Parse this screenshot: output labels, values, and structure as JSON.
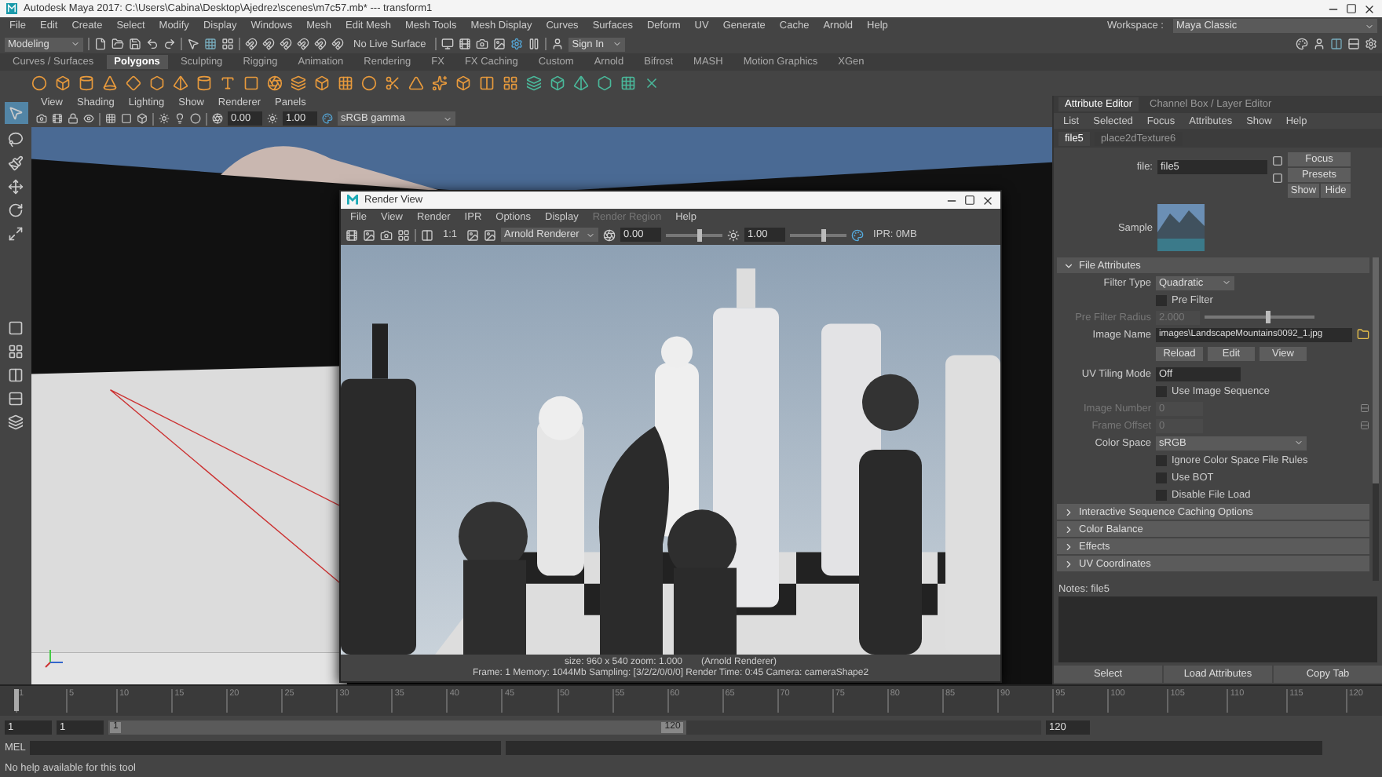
{
  "window": {
    "title": "Autodesk Maya 2017: C:\\Users\\Cabina\\Desktop\\Ajedrez\\scenes\\m7c57.mb*  ---  transform1"
  },
  "main_menu": [
    "File",
    "Edit",
    "Create",
    "Select",
    "Modify",
    "Display",
    "Windows",
    "Mesh",
    "Edit Mesh",
    "Mesh Tools",
    "Mesh Display",
    "Curves",
    "Surfaces",
    "Deform",
    "UV",
    "Generate",
    "Cache",
    "Arnold",
    "Help"
  ],
  "workspace": {
    "label": "Workspace :",
    "value": "Maya Classic"
  },
  "status_line": {
    "mode": "Modeling",
    "live_surface": "No Live Surface",
    "sign_in": "Sign In"
  },
  "shelf_tabs": [
    {
      "label": "Curves / Surfaces",
      "selected": false
    },
    {
      "label": "Polygons",
      "selected": true
    },
    {
      "label": "Sculpting",
      "selected": false
    },
    {
      "label": "Rigging",
      "selected": false
    },
    {
      "label": "Animation",
      "selected": false
    },
    {
      "label": "Rendering",
      "selected": false
    },
    {
      "label": "FX",
      "selected": false
    },
    {
      "label": "FX Caching",
      "selected": false
    },
    {
      "label": "Custom",
      "selected": false
    },
    {
      "label": "Arnold",
      "selected": false
    },
    {
      "label": "Bifrost",
      "selected": false
    },
    {
      "label": "MASH",
      "selected": false
    },
    {
      "label": "Motion Graphics",
      "selected": false
    },
    {
      "label": "XGen",
      "selected": false
    }
  ],
  "viewport": {
    "menu": [
      "View",
      "Shading",
      "Lighting",
      "Show",
      "Renderer",
      "Panels"
    ],
    "exposure": "0.00",
    "gamma": "1.00",
    "color_space": "sRGB gamma"
  },
  "render_view": {
    "title": "Render View",
    "menu": [
      {
        "label": "File",
        "disabled": false
      },
      {
        "label": "View",
        "disabled": false
      },
      {
        "label": "Render",
        "disabled": false
      },
      {
        "label": "IPR",
        "disabled": false
      },
      {
        "label": "Options",
        "disabled": false
      },
      {
        "label": "Display",
        "disabled": false
      },
      {
        "label": "Render Region",
        "disabled": true
      },
      {
        "label": "Help",
        "disabled": false
      }
    ],
    "ratio": "1:1",
    "renderer": "Arnold Renderer",
    "exposure": "0.00",
    "gamma": "1.00",
    "ipr": "IPR: 0MB",
    "size_line": "size: 960 x 540 zoom: 1.000",
    "renderer_note": "(Arnold Renderer)",
    "status": "Frame: 1   Memory: 1044Mb   Sampling: [3/2/2/0/0/0]   Render Time: 0:45   Camera: cameraShape2"
  },
  "attribute_editor": {
    "tabs": [
      {
        "label": "Attribute Editor",
        "selected": true
      },
      {
        "label": "Channel Box / Layer Editor",
        "selected": false
      }
    ],
    "menu": [
      "List",
      "Selected",
      "Focus",
      "Attributes",
      "Show",
      "Help"
    ],
    "node_tabs": [
      {
        "label": "file5",
        "selected": true
      },
      {
        "label": "place2dTexture6",
        "selected": false
      }
    ],
    "node_label": "file:",
    "node_name": "file5",
    "focus": "Focus",
    "presets": "Presets",
    "show": "Show",
    "hide": "Hide",
    "sample_label": "Sample",
    "sections": [
      {
        "label": "File Attributes",
        "expanded": true,
        "rows": [
          {
            "kind": "dropdown",
            "label": "Filter Type",
            "value": "Quadratic",
            "disabled": false
          },
          {
            "kind": "checkbox",
            "label": "Pre Filter",
            "checked": false,
            "disabled": false
          },
          {
            "kind": "slider",
            "label": "Pre Filter Radius",
            "value": "2.000",
            "level": 0.55,
            "disabled": true
          },
          {
            "kind": "path",
            "label": "Image Name",
            "value": "images\\LandscapeMountains0092_1.jpg",
            "disabled": false
          },
          {
            "kind": "buttons",
            "buttons": [
              "Reload",
              "Edit",
              "View"
            ]
          },
          {
            "kind": "field",
            "label": "UV Tiling Mode",
            "value": "Off",
            "disabled": false
          },
          {
            "kind": "checkbox",
            "label": "Use Image Sequence",
            "checked": false,
            "disabled": false
          },
          {
            "kind": "spinner",
            "label": "Image Number",
            "value": "0",
            "disabled": true
          },
          {
            "kind": "spinner",
            "label": "Frame Offset",
            "value": "0",
            "disabled": true
          },
          {
            "kind": "wide_dropdown",
            "label": "Color Space",
            "value": "sRGB",
            "disabled": false
          },
          {
            "kind": "checkbox",
            "label": "Ignore Color Space File Rules",
            "checked": false,
            "disabled": false
          },
          {
            "kind": "checkbox",
            "label": "Use BOT",
            "checked": false,
            "disabled": false
          },
          {
            "kind": "checkbox",
            "label": "Disable File Load",
            "checked": false,
            "disabled": false
          }
        ]
      },
      {
        "label": "Interactive Sequence Caching Options",
        "expanded": false
      },
      {
        "label": "Color Balance",
        "expanded": false
      },
      {
        "label": "Effects",
        "expanded": false
      },
      {
        "label": "UV Coordinates",
        "expanded": false
      }
    ],
    "notes_label": "Notes:  file5",
    "bottom_buttons": [
      "Select",
      "Load Attributes",
      "Copy Tab"
    ]
  },
  "timeline": {
    "level": 0,
    "ticks": [
      "1",
      "5",
      "10",
      "15",
      "20",
      "25",
      "30",
      "35",
      "40",
      "45",
      "50",
      "55",
      "60",
      "65",
      "70",
      "75",
      "80",
      "85",
      "90",
      "95",
      "100",
      "105",
      "110",
      "115",
      "120"
    ]
  },
  "range": {
    "level": 0.62,
    "start": "1",
    "playback_start": "1",
    "slider_start": "1",
    "slider_end": "120",
    "end": "120"
  },
  "command_line": {
    "label": "MEL"
  },
  "help_line": "No help available for this tool"
}
